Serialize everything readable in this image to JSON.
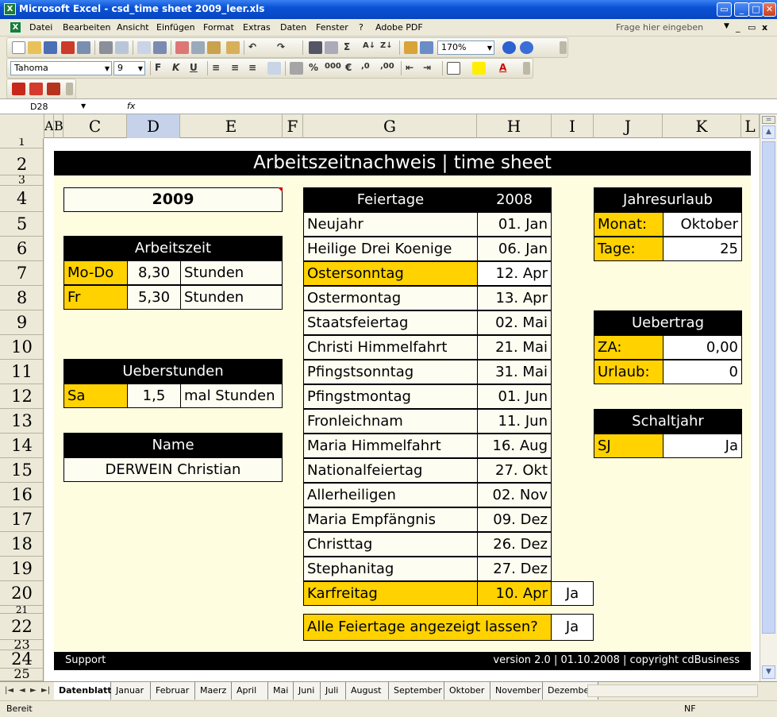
{
  "window": {
    "title": "Microsoft Excel - csd_time sheet 2009_leer.xls",
    "logo": "X"
  },
  "menu": [
    "Datei",
    "Bearbeiten",
    "Ansicht",
    "Einfügen",
    "Format",
    "Extras",
    "Daten",
    "Fenster",
    "?",
    "Adobe PDF"
  ],
  "ask_placeholder": "Frage hier eingeben",
  "toolbar": {
    "zoom": "170%",
    "font": "Tahoma",
    "size": "9"
  },
  "formula": {
    "namebox": "D28",
    "fx": "fx",
    "value": ""
  },
  "columns": [
    "A",
    "B",
    "C",
    "D",
    "E",
    "F",
    "G",
    "H",
    "I",
    "J",
    "K",
    "L"
  ],
  "rows": [
    "1",
    "2",
    "3",
    "4",
    "5",
    "6",
    "7",
    "8",
    "9",
    "10",
    "11",
    "12",
    "13",
    "14",
    "15",
    "16",
    "17",
    "18",
    "19",
    "20",
    "21",
    "22",
    "23",
    "24",
    "25"
  ],
  "sheet": {
    "title": "Arbeitszeitnachweis | time sheet",
    "year": "2009",
    "arbeitszeit": {
      "header": "Arbeitszeit",
      "rows": [
        {
          "day": "Mo-Do",
          "value": "8,30",
          "unit": "Stunden"
        },
        {
          "day": "Fr",
          "value": "5,30",
          "unit": "Stunden"
        }
      ]
    },
    "ueberstunden": {
      "header": "Ueberstunden",
      "day": "Sa",
      "value": "1,5",
      "unit": "mal Stunden"
    },
    "name": {
      "header": "Name",
      "value": "DERWEIN Christian"
    },
    "feiertage": {
      "header": "Feiertage",
      "year": "2008",
      "rows": [
        {
          "name": "Neujahr",
          "date": "01. Jan",
          "hl": false
        },
        {
          "name": "Heilige Drei Koenige",
          "date": "06. Jan",
          "hl": false
        },
        {
          "name": "Ostersonntag",
          "date": "12. Apr",
          "hl": true
        },
        {
          "name": "Ostermontag",
          "date": "13. Apr",
          "hl": false
        },
        {
          "name": "Staatsfeiertag",
          "date": "02. Mai",
          "hl": false
        },
        {
          "name": "Christi Himmelfahrt",
          "date": "21. Mai",
          "hl": false
        },
        {
          "name": "Pfingstsonntag",
          "date": "31. Mai",
          "hl": false
        },
        {
          "name": "Pfingstmontag",
          "date": "01. Jun",
          "hl": false
        },
        {
          "name": "Fronleichnam",
          "date": "11. Jun",
          "hl": false
        },
        {
          "name": "Maria Himmelfahrt",
          "date": "16. Aug",
          "hl": false
        },
        {
          "name": "Nationalfeiertag",
          "date": "27. Okt",
          "hl": false
        },
        {
          "name": "Allerheiligen",
          "date": "02. Nov",
          "hl": false
        },
        {
          "name": "Maria Empfängnis",
          "date": "09. Dez",
          "hl": false
        },
        {
          "name": "Christtag",
          "date": "26. Dez",
          "hl": false
        },
        {
          "name": "Stephanitag",
          "date": "27. Dez",
          "hl": false
        }
      ],
      "karfreitag": {
        "name": "Karfreitag",
        "date": "10. Apr",
        "flag": "Ja"
      },
      "show_all": {
        "label": "Alle Feiertage angezeigt lassen?",
        "value": "Ja"
      }
    },
    "jahresurlaub": {
      "header": "Jahresurlaub",
      "monat_label": "Monat:",
      "monat": "Oktober",
      "tage_label": "Tage:",
      "tage": "25"
    },
    "uebertrag": {
      "header": "Uebertrag",
      "za_label": "ZA:",
      "za": "0,00",
      "urlaub_label": "Urlaub:",
      "urlaub": "0"
    },
    "schaltjahr": {
      "header": "Schaltjahr",
      "label": "SJ",
      "value": "Ja"
    },
    "footer": {
      "left": "Support",
      "right": "version 2.0 | 01.10.2008 | copyright cdBusiness"
    }
  },
  "tabs": [
    "Datenblatt",
    "Januar",
    "Februar",
    "Maerz",
    "April",
    "Mai",
    "Juni",
    "Juli",
    "August",
    "September",
    "Oktober",
    "November",
    "Dezember"
  ],
  "status": {
    "left": "Bereit",
    "right": "NF"
  },
  "colors": {
    "yellow": "#ffd200",
    "panel": "#fefde0",
    "titlebar": "#0a52d6"
  }
}
